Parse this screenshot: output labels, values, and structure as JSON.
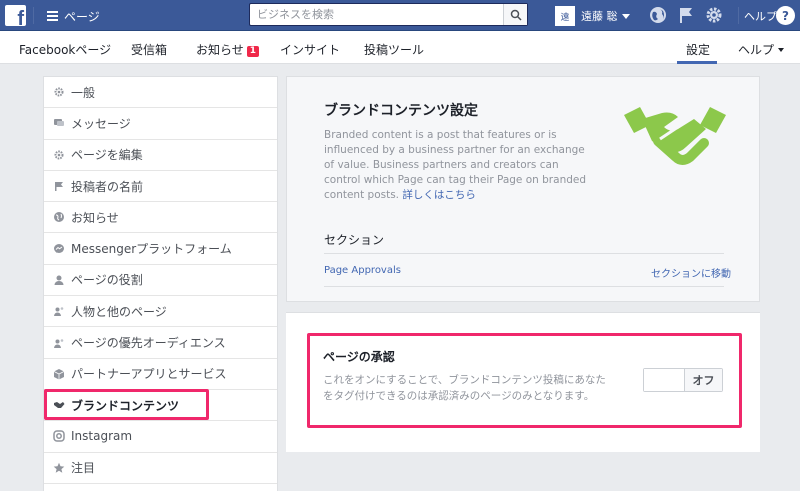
{
  "topbar": {
    "title": "ページ",
    "search_placeholder": "ビジネスを検索",
    "user_name": "遠藤 聡",
    "avatar_text": "遠",
    "help_label": "ヘルプ",
    "help_icon": "?"
  },
  "nav": {
    "items": [
      {
        "label": "Facebookページ"
      },
      {
        "label": "受信箱"
      },
      {
        "label": "お知らせ",
        "badge": "1"
      },
      {
        "label": "インサイト"
      },
      {
        "label": "投稿ツール"
      },
      {
        "label": "設定",
        "active": true
      },
      {
        "label": "ヘルプ"
      }
    ]
  },
  "sidebar": {
    "items": [
      {
        "label": "一般",
        "icon": "gear-icon"
      },
      {
        "label": "メッセージ",
        "icon": "chat-icon"
      },
      {
        "label": "ページを編集",
        "icon": "gear-icon"
      },
      {
        "label": "投稿者の名前",
        "icon": "flag-icon"
      },
      {
        "label": "お知らせ",
        "icon": "globe-icon"
      },
      {
        "label": "Messengerプラットフォーム",
        "icon": "messenger-icon"
      },
      {
        "label": "ページの役割",
        "icon": "person-icon"
      },
      {
        "label": "人物と他のページ",
        "icon": "people-icon"
      },
      {
        "label": "ページの優先オーディエンス",
        "icon": "people-icon"
      },
      {
        "label": "パートナーアプリとサービス",
        "icon": "cube-icon"
      },
      {
        "label": "ブランドコンテンツ",
        "icon": "handshake-icon",
        "active": true
      },
      {
        "label": "Instagram",
        "icon": "instagram-icon"
      },
      {
        "label": "注目",
        "icon": "star-icon"
      }
    ]
  },
  "main": {
    "title": "ブランドコンテンツ設定",
    "description": "Branded content is a post that features or is influenced by a business partner for an exchange of value. Business partners and creators can control which Page can tag their Page on branded content posts.",
    "learn_more": "詳しくはこちら",
    "section_label": "セクション",
    "section_link": "Page Approvals",
    "section_go": "セクションに移動"
  },
  "approval": {
    "title": "ページの承認",
    "description": "これをオンにすることで、ブランドコンテンツ投稿にあなたをタグ付けできるのは承認済みのページのみとなります。",
    "toggle_label": "オフ"
  },
  "colors": {
    "brand_blue": "#3b5998",
    "link_blue": "#4267b2",
    "highlight_pink": "#f0286b",
    "handshake_green": "#8cc84b"
  }
}
